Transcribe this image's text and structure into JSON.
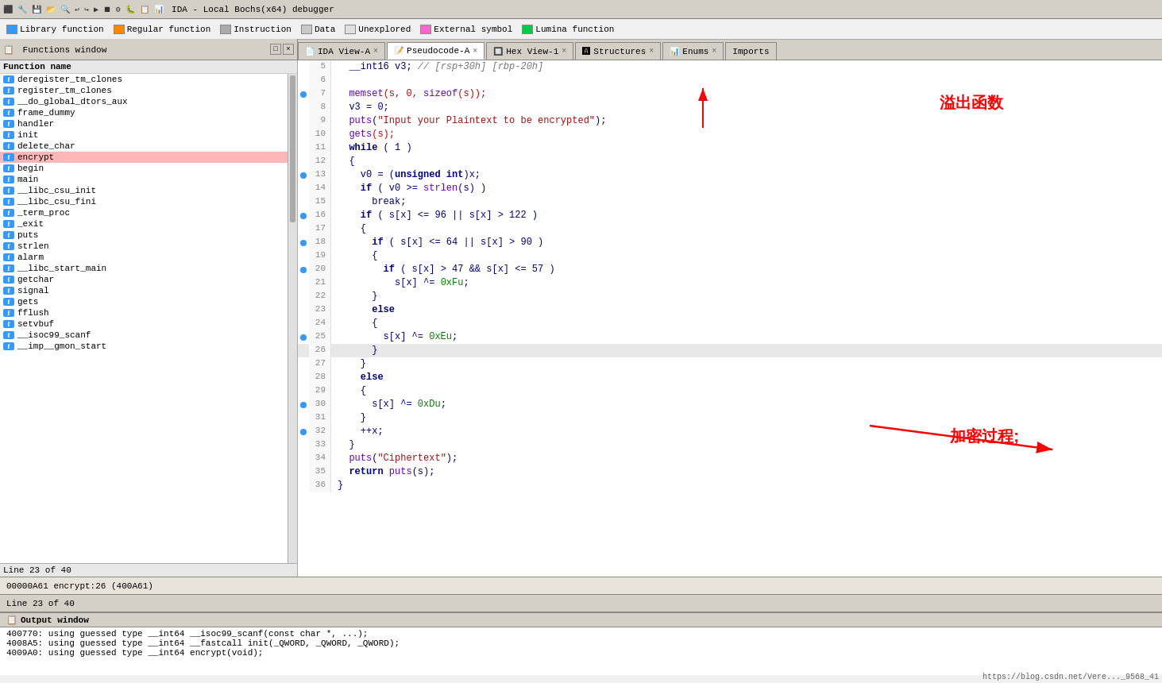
{
  "toolbar": {
    "title": "IDA - Local Bochs(x64) debugger"
  },
  "legend": {
    "items": [
      {
        "label": "Library function",
        "color": "#3399ff"
      },
      {
        "label": "Regular function",
        "color": "#ff8800"
      },
      {
        "label": "Instruction",
        "color": "#c0c0c0"
      },
      {
        "label": "Data",
        "color": "#c0c0c0"
      },
      {
        "label": "Unexplored",
        "color": "#c0c0c0"
      },
      {
        "label": "External symbol",
        "color": "#ff66cc"
      },
      {
        "label": "Lumina function",
        "color": "#00cc44"
      }
    ]
  },
  "sidebar": {
    "title": "Functions window",
    "col_header": "Function name",
    "functions": [
      {
        "name": "deregister_tm_clones",
        "selected": false
      },
      {
        "name": "register_tm_clones",
        "selected": false
      },
      {
        "name": "__do_global_dtors_aux",
        "selected": false
      },
      {
        "name": "frame_dummy",
        "selected": false
      },
      {
        "name": "handler",
        "selected": false
      },
      {
        "name": "init",
        "selected": false
      },
      {
        "name": "delete_char",
        "selected": false
      },
      {
        "name": "encrypt",
        "selected": true
      },
      {
        "name": "begin",
        "selected": false
      },
      {
        "name": "main",
        "selected": false
      },
      {
        "name": "__libc_csu_init",
        "selected": false
      },
      {
        "name": "__libc_csu_fini",
        "selected": false
      },
      {
        "name": "_term_proc",
        "selected": false
      },
      {
        "name": "_exit",
        "selected": false
      },
      {
        "name": "puts",
        "selected": false
      },
      {
        "name": "strlen",
        "selected": false
      },
      {
        "name": "alarm",
        "selected": false
      },
      {
        "name": "__libc_start_main",
        "selected": false
      },
      {
        "name": "getchar",
        "selected": false
      },
      {
        "name": "signal",
        "selected": false
      },
      {
        "name": "gets",
        "selected": false
      },
      {
        "name": "fflush",
        "selected": false
      },
      {
        "name": "setvbuf",
        "selected": false
      },
      {
        "name": "__isoc99_scanf",
        "selected": false
      },
      {
        "name": "__imp__gmon_start",
        "selected": false
      }
    ],
    "footer": "Line 23 of 40"
  },
  "tabs": [
    {
      "label": "IDA View-A",
      "active": false,
      "closeable": true
    },
    {
      "label": "Pseudocode-A",
      "active": true,
      "closeable": true
    },
    {
      "label": "Hex View-1",
      "active": false,
      "closeable": true
    },
    {
      "label": "Structures",
      "active": false,
      "closeable": true
    },
    {
      "label": "Enums",
      "active": false,
      "closeable": true
    },
    {
      "label": "Imports",
      "active": false,
      "closeable": false
    }
  ],
  "code": {
    "lines": [
      {
        "num": 5,
        "dot": false,
        "content": "  __int16 v3; // [rsp+30h] [rbp-20h]",
        "special": "comment"
      },
      {
        "num": 6,
        "dot": false,
        "content": ""
      },
      {
        "num": 7,
        "dot": true,
        "content": "  memset(s, 0, sizeof(s));",
        "special": "highlight_red"
      },
      {
        "num": 8,
        "dot": false,
        "content": "  v3 = 0;"
      },
      {
        "num": 9,
        "dot": false,
        "content": "  puts(\"Input your Plaintext to be encrypted\");"
      },
      {
        "num": 10,
        "dot": false,
        "content": "  gets(s);",
        "special": "highlight_red"
      },
      {
        "num": 11,
        "dot": false,
        "content": "  while ( 1 )"
      },
      {
        "num": 12,
        "dot": false,
        "content": "  {"
      },
      {
        "num": 13,
        "dot": true,
        "content": "    v0 = (unsigned int)x;"
      },
      {
        "num": 14,
        "dot": false,
        "content": "    if ( v0 >= strlen(s) )"
      },
      {
        "num": 15,
        "dot": false,
        "content": "      break;"
      },
      {
        "num": 16,
        "dot": true,
        "content": "    if ( s[x] <= 96 || s[x] > 122 )"
      },
      {
        "num": 17,
        "dot": false,
        "content": "    {"
      },
      {
        "num": 18,
        "dot": true,
        "content": "      if ( s[x] <= 64 || s[x] > 90 )"
      },
      {
        "num": 19,
        "dot": false,
        "content": "      {"
      },
      {
        "num": 20,
        "dot": true,
        "content": "        if ( s[x] > 47 && s[x] <= 57 )"
      },
      {
        "num": 21,
        "dot": false,
        "content": "          s[x] ^= 0xFu;"
      },
      {
        "num": 22,
        "dot": false,
        "content": "      }"
      },
      {
        "num": 23,
        "dot": false,
        "content": "      else"
      },
      {
        "num": 24,
        "dot": false,
        "content": "      {"
      },
      {
        "num": 25,
        "dot": true,
        "content": "        s[x] ^= 0xEu;"
      },
      {
        "num": 26,
        "dot": false,
        "content": "      }",
        "special": "bg_gray"
      },
      {
        "num": 27,
        "dot": false,
        "content": "    }"
      },
      {
        "num": 28,
        "dot": false,
        "content": "    else"
      },
      {
        "num": 29,
        "dot": false,
        "content": "    {"
      },
      {
        "num": 30,
        "dot": true,
        "content": "      s[x] ^= 0xDu;"
      },
      {
        "num": 31,
        "dot": false,
        "content": "    }"
      },
      {
        "num": 32,
        "dot": true,
        "content": "    ++x;"
      },
      {
        "num": 33,
        "dot": false,
        "content": "  }"
      },
      {
        "num": 34,
        "dot": false,
        "content": "  puts(\"Ciphertext\");"
      },
      {
        "num": 35,
        "dot": false,
        "content": "  return puts(s);"
      },
      {
        "num": 36,
        "dot": false,
        "content": "}"
      }
    ]
  },
  "annotations": {
    "overflow": "溢出函数",
    "encrypt_process": "加密过程;"
  },
  "status": {
    "left": "Line 23 of 40",
    "addr": "00000A61 encrypt:26 (400A61)"
  },
  "output": {
    "title": "Output window",
    "lines": [
      "400770: using guessed type __int64 __isoc99_scanf(const char *, ...);",
      "4008A5: using guessed type __int64 __fastcall init(_QWORD, _QWORD, _QWORD);",
      "4009A0: using guessed type __int64 encrypt(void);"
    ]
  },
  "url": "https://blog.csdn.net/Vere..._9568_41"
}
